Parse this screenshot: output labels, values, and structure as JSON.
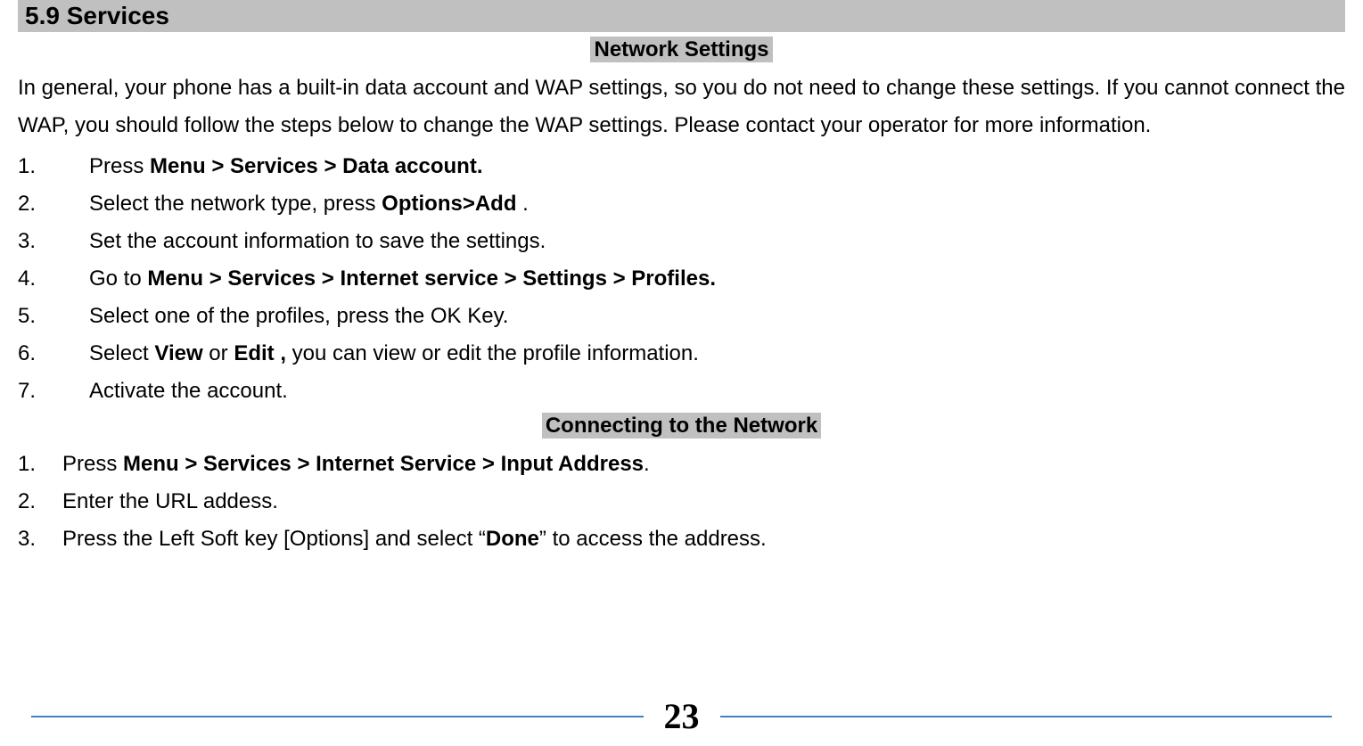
{
  "section": {
    "heading": "5.9 Services",
    "networkSettings": {
      "title": "Network Settings",
      "intro": "In general, your phone has a built-in data account and WAP settings, so you do not need to change these settings. If you cannot connect the WAP, you should follow the steps below to change the WAP settings. Please contact your operator for more information.",
      "steps": [
        {
          "num": "1.",
          "prefix": "Press ",
          "bold1": "Menu > Services > Data account.",
          "suffix": ""
        },
        {
          "num": "2.",
          "prefix": "Select the network type, press ",
          "bold1": "Options>Add",
          "suffix": " ."
        },
        {
          "num": "3.",
          "prefix": "Set the account information to save the settings.",
          "bold1": "",
          "suffix": ""
        },
        {
          "num": "4.",
          "prefix": "Go to ",
          "bold1": "Menu > Services > Internet service > Settings > Profiles.",
          "suffix": ""
        },
        {
          "num": "5.",
          "prefix": "Select one of the profiles, press the OK Key.",
          "bold1": "",
          "suffix": ""
        },
        {
          "num": "6.",
          "prefix": "Select ",
          "bold1": "View",
          "mid": " or ",
          "bold2": "Edit ,",
          "suffix": " you can view or edit the profile information."
        },
        {
          "num": "7.",
          "prefix": "Activate the account.",
          "bold1": "",
          "suffix": ""
        }
      ]
    },
    "connecting": {
      "title": "Connecting to the Network",
      "steps": [
        {
          "num": "1.",
          "prefix": "Press ",
          "bold1": "Menu > Services > Internet Service > Input Address",
          "suffix": "."
        },
        {
          "num": "2.",
          "prefix": "Enter the URL addess.",
          "bold1": "",
          "suffix": ""
        },
        {
          "num": "3.",
          "prefix": "Press the Left Soft key [Options] and select “",
          "bold1": "Done",
          "suffix": "” to access the address."
        }
      ]
    }
  },
  "pageNumber": "23"
}
